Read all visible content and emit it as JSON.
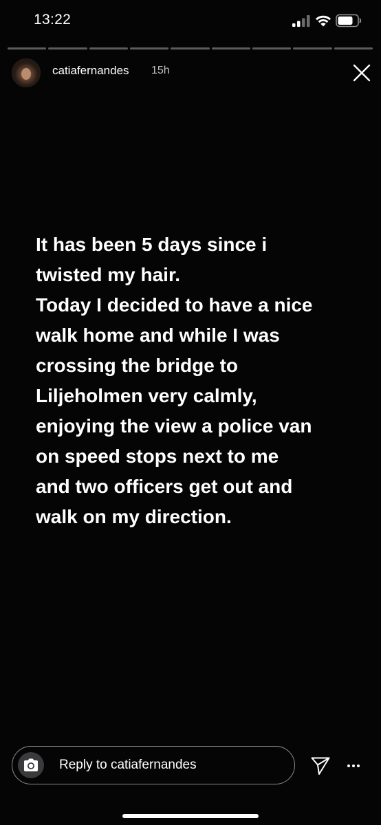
{
  "status_bar": {
    "time": "13:22",
    "signal_icon": "cellular-signal-icon",
    "wifi_icon": "wifi-icon",
    "battery_icon": "battery-icon"
  },
  "progress": {
    "segment_count": 9,
    "filled_count": 0
  },
  "header": {
    "username": "catiafernandes",
    "timestamp": "15h",
    "avatar_icon": "avatar",
    "close_icon": "close-icon"
  },
  "story": {
    "lines": [
      "It has been 5 days since i",
      "twisted my hair.",
      "Today I decided to have a nice",
      "walk home and while I was",
      "crossing the bridge to",
      "Liljeholmen very calmly,",
      "enjoying the view a police van",
      "on speed stops next to me",
      "and two officers get out and",
      "walk on my direction."
    ]
  },
  "reply": {
    "placeholder": "Reply to catiafernandes",
    "value": "",
    "camera_icon": "camera-icon",
    "send_icon": "send-icon",
    "more_icon": "more-icon"
  },
  "colors": {
    "background": "#050505",
    "text": "#ffffff",
    "progress_track": "#5a5a5a",
    "camera_button_bg": "#3a3a3c"
  }
}
